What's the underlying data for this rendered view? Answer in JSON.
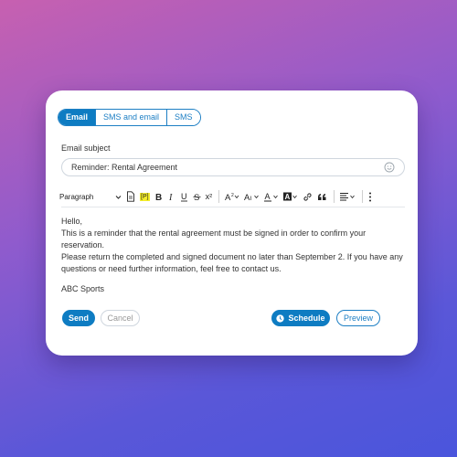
{
  "tabs": [
    {
      "label": "Email",
      "active": true
    },
    {
      "label": "SMS and email",
      "active": false
    },
    {
      "label": "SMS",
      "active": false
    }
  ],
  "subject": {
    "label": "Email subject",
    "value": "Reminder: Rental Agreement"
  },
  "toolbar": {
    "paragraph_style": "Paragraph",
    "variable_label": "[P]",
    "superscript_label": "x²"
  },
  "body": {
    "greeting": "Hello,",
    "line1": "This is a reminder that the rental agreement must be signed in order to confirm your reservation.",
    "line2": "Please return the completed and signed document no later than September 2. If you have any questions or need further information, feel free to contact us.",
    "signature": "ABC Sports"
  },
  "actions": {
    "send": "Send",
    "cancel": "Cancel",
    "schedule": "Schedule",
    "preview": "Preview"
  },
  "colors": {
    "accent": "#0e7cc2",
    "highlight": "#f5ee2a"
  }
}
